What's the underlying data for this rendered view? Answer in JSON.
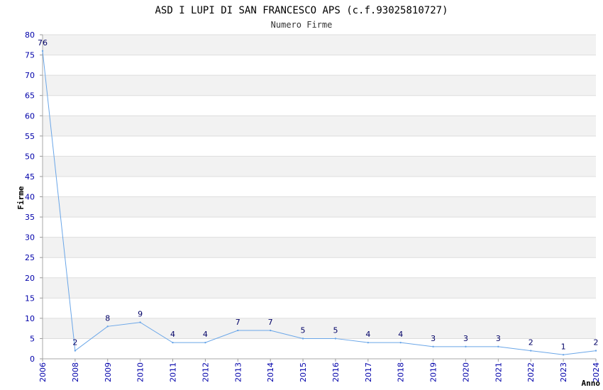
{
  "chart_data": {
    "type": "line",
    "title": "ASD I LUPI DI SAN FRANCESCO APS (c.f.93025810727)",
    "subtitle": "Numero Firme",
    "xlabel": "Anno",
    "ylabel": "Firme",
    "ylim": [
      0,
      80
    ],
    "ystep": 5,
    "x": [
      "2006",
      "2008",
      "2009",
      "2010",
      "2011",
      "2012",
      "2013",
      "2014",
      "2015",
      "2016",
      "2017",
      "2018",
      "2019",
      "2020",
      "2021",
      "2022",
      "2023",
      "2024"
    ],
    "values": [
      76,
      2,
      8,
      9,
      4,
      4,
      7,
      7,
      5,
      5,
      4,
      4,
      3,
      3,
      3,
      2,
      1,
      2
    ],
    "grid": true,
    "colors": {
      "line": "#6aa6e8",
      "band": "#f2f2f2",
      "gridline": "#dddddd",
      "tick_text": "#0000aa",
      "value_text": "#000066"
    }
  }
}
